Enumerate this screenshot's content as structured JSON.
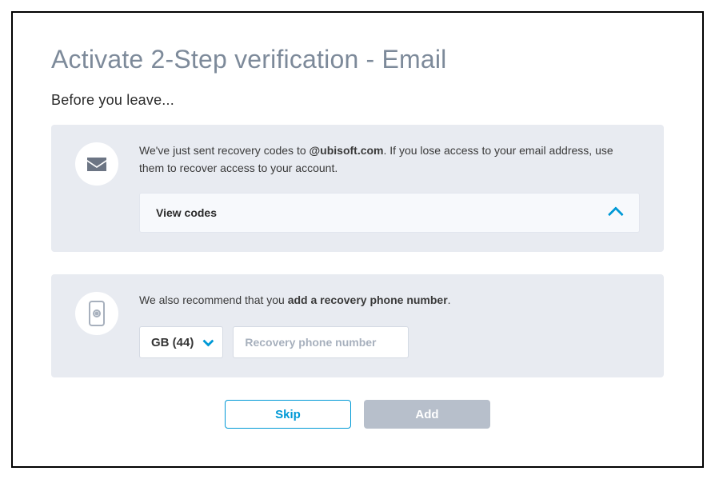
{
  "title": "Activate 2-Step verification - Email",
  "subtitle": "Before you leave...",
  "recovery": {
    "text_before": "We've just sent recovery codes to ",
    "email_prefix": "",
    "email_domain": "@ubisoft.com",
    "text_after": ". If you lose access to your email address, use them to recover access to your account.",
    "view_codes_label": "View codes"
  },
  "phone": {
    "text_before": "We also recommend that you ",
    "bold_part": "add a recovery phone number",
    "text_after": ".",
    "country_label": "GB (44)",
    "input_placeholder": "Recovery phone number"
  },
  "footer": {
    "skip": "Skip",
    "add": "Add"
  }
}
